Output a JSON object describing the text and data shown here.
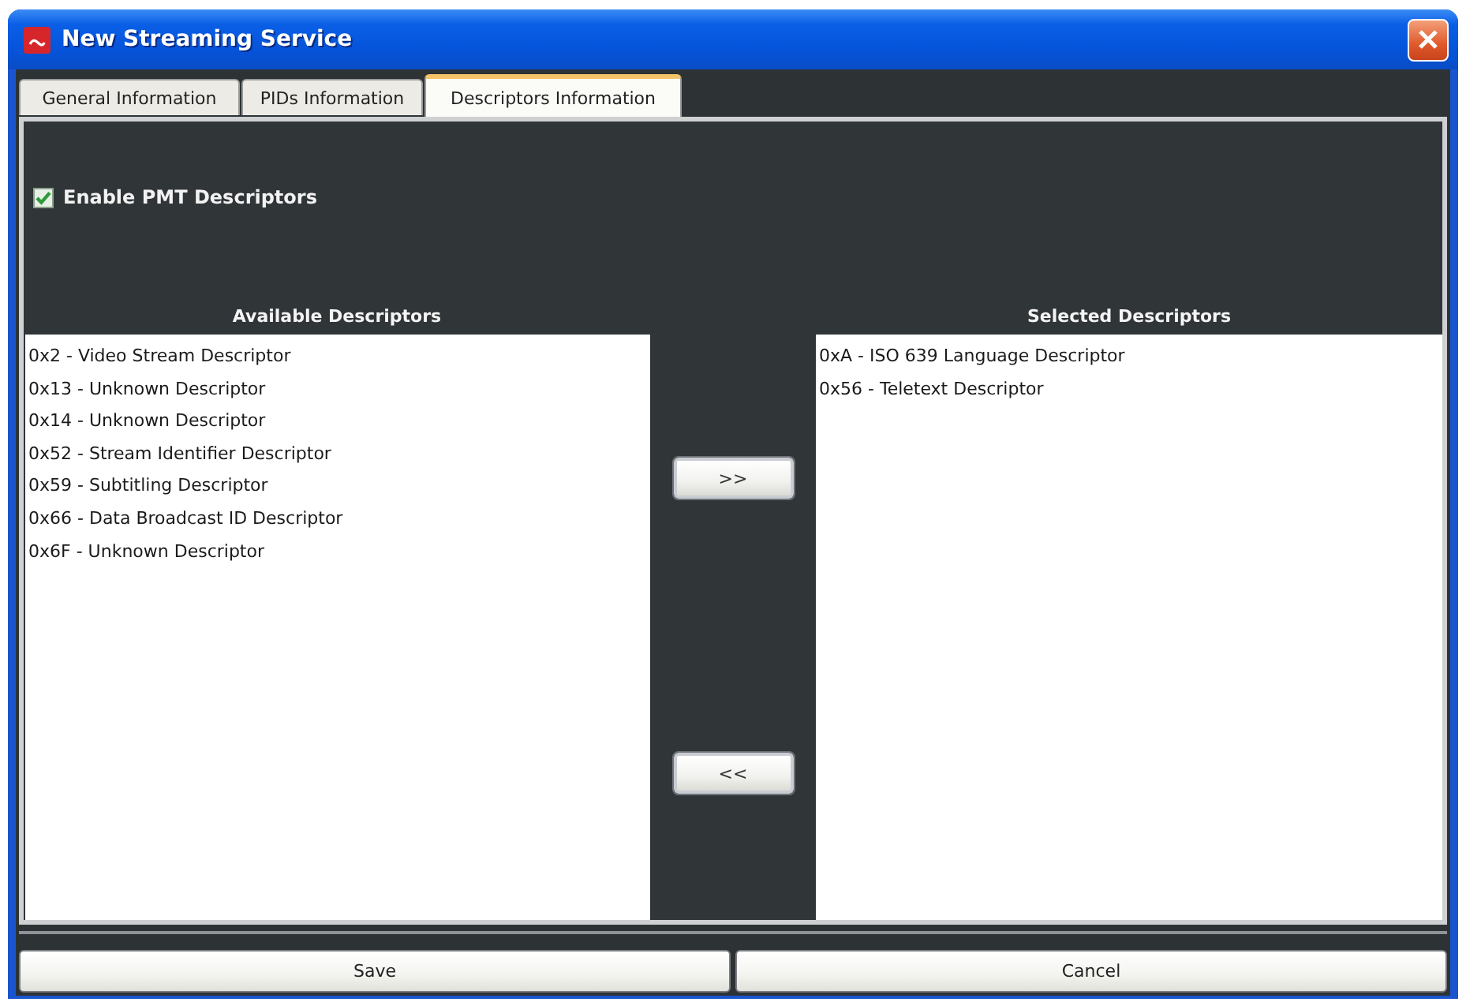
{
  "window": {
    "title": "New Streaming Service"
  },
  "tabs": [
    {
      "label": "General Information",
      "selected": false
    },
    {
      "label": "PIDs Information",
      "selected": false
    },
    {
      "label": "Descriptors Information",
      "selected": true
    }
  ],
  "enable_pmt": {
    "label": "Enable PMT Descriptors",
    "checked": true
  },
  "available": {
    "title": "Available Descriptors",
    "items": [
      "0x2 - Video Stream Descriptor",
      "0x13 - Unknown Descriptor",
      "0x14 - Unknown Descriptor",
      "0x52 - Stream Identifier Descriptor",
      "0x59 - Subtitling Descriptor",
      "0x66 - Data Broadcast ID Descriptor",
      "0x6F - Unknown Descriptor"
    ]
  },
  "transfer_buttons": [
    ">>",
    "<<"
  ],
  "selected": {
    "title": "Selected Descriptors",
    "items": [
      "0xA - ISO 639 Language Descriptor",
      "0x56 - Teletext Descriptor"
    ]
  },
  "buttons": [
    "Save",
    "Cancel"
  ]
}
